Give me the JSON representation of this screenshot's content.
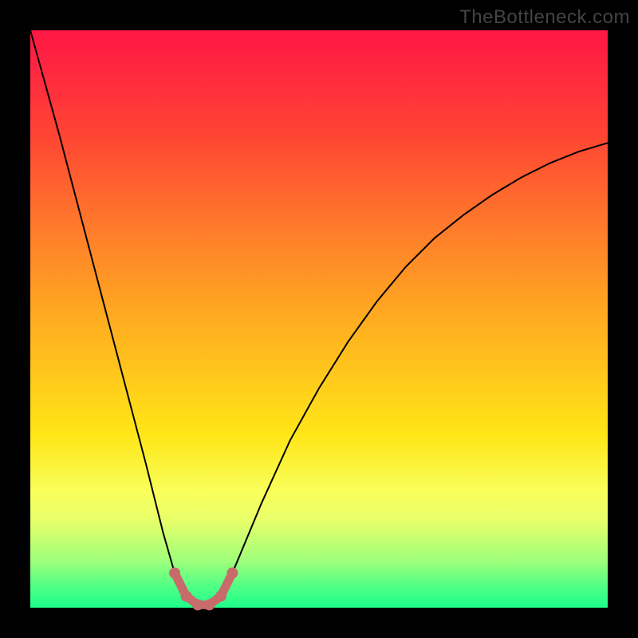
{
  "watermark": "TheBottleneck.com",
  "chart_data": {
    "type": "line",
    "title": "",
    "xlabel": "",
    "ylabel": "",
    "xlim": [
      0,
      100
    ],
    "ylim": [
      0,
      100
    ],
    "series": [
      {
        "name": "bottleneck-curve",
        "x": [
          0,
          5,
          10,
          15,
          20,
          23,
          25,
          27,
          29,
          31,
          33,
          35,
          40,
          45,
          50,
          55,
          60,
          65,
          70,
          75,
          80,
          85,
          90,
          95,
          100
        ],
        "y": [
          100,
          82,
          63,
          44,
          25,
          13,
          6,
          2,
          0.5,
          0.5,
          2,
          6,
          18,
          29,
          38,
          46,
          53,
          59,
          64,
          68,
          71.5,
          74.5,
          77,
          79,
          80.5
        ]
      }
    ],
    "highlight_band": {
      "name": "optimal-region",
      "x": [
        25,
        27,
        29,
        31,
        33,
        35
      ],
      "y": [
        6,
        2,
        0.5,
        0.5,
        2,
        6
      ]
    },
    "background_gradient": {
      "top": "#ff1744",
      "mid": "#ffe617",
      "bottom": "#1dff8a"
    }
  }
}
